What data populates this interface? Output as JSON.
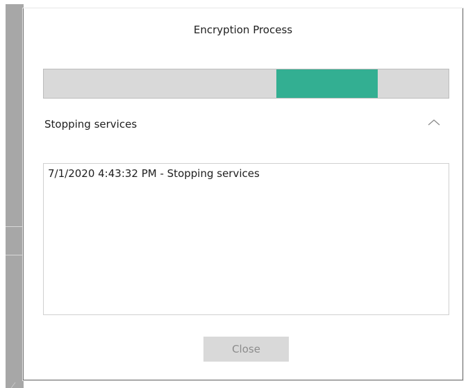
{
  "dialog": {
    "title": "Encryption Process",
    "progress": {
      "segment_start_percent": 57.5,
      "segment_end_percent": 82.5,
      "indeterminate": true,
      "fill_color": "#33af92",
      "track_color": "#d9d9d9"
    },
    "status_label": "Stopping services",
    "collapse_icon": "chevron-up-icon",
    "log": {
      "lines": [
        "7/1/2020 4:43:32 PM - Stopping services"
      ]
    },
    "close_button": {
      "label": "Close",
      "enabled": false
    }
  }
}
